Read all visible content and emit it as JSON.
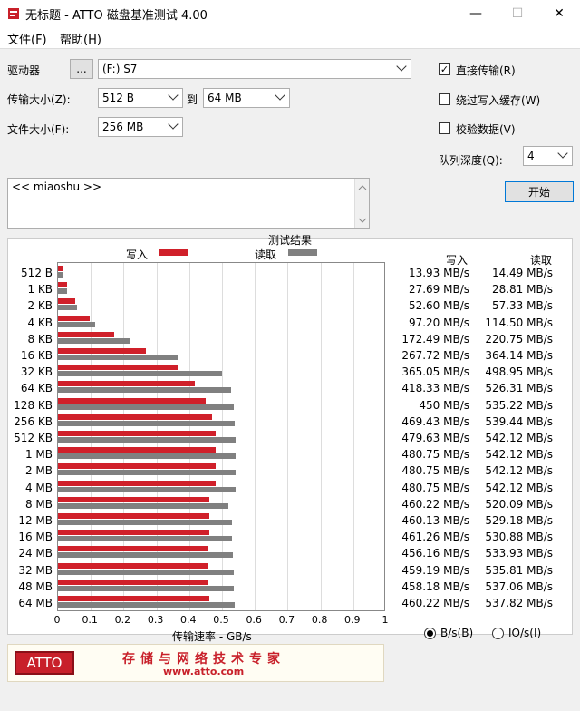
{
  "window": {
    "title": "无标题 - ATTO 磁盘基准测试 4.00",
    "minimize": "—",
    "maximize": "☐",
    "close": "✕"
  },
  "menu": {
    "file": "文件(F)",
    "help": "帮助(H)"
  },
  "drive": {
    "label": "驱动器",
    "browse": "...",
    "value": "(F:) S7"
  },
  "transfer": {
    "label": "传输大小(Z):",
    "from": "512 B",
    "to_label": "到",
    "to": "64 MB"
  },
  "filesize": {
    "label": "文件大小(F):",
    "value": "256 MB"
  },
  "options": {
    "direct_io": {
      "label": "直接传输(R)",
      "checked": true
    },
    "bypass_cache": {
      "label": "绕过写入缓存(W)",
      "checked": false
    },
    "verify": {
      "label": "校验数据(V)",
      "checked": false
    },
    "queue_label": "队列深度(Q):",
    "queue_value": "4",
    "start": "开始"
  },
  "notes": {
    "text": "<< miaoshu >>"
  },
  "results": {
    "title": "测试结果",
    "write_legend": "写入",
    "read_legend": "读取",
    "col_write": "写入",
    "col_read": "读取",
    "xlabel": "传输速率 - GB/s",
    "colors": {
      "write": "#d0202a",
      "read": "#808080"
    }
  },
  "chart_data": {
    "type": "bar",
    "title": "测试结果",
    "xlabel": "传输速率 - GB/s",
    "xlim": [
      0,
      1
    ],
    "xticks": [
      "0",
      "0.1",
      "0.2",
      "0.3",
      "0.4",
      "0.5",
      "0.6",
      "0.7",
      "0.8",
      "0.9",
      "1"
    ],
    "categories": [
      "512 B",
      "1 KB",
      "2 KB",
      "4 KB",
      "8 KB",
      "16 KB",
      "32 KB",
      "64 KB",
      "128 KB",
      "256 KB",
      "512 KB",
      "1 MB",
      "2 MB",
      "4 MB",
      "8 MB",
      "12 MB",
      "16 MB",
      "24 MB",
      "32 MB",
      "48 MB",
      "64 MB"
    ],
    "series": [
      {
        "name": "写入",
        "values": [
          0.01393,
          0.02769,
          0.0526,
          0.0972,
          0.17249,
          0.26772,
          0.36505,
          0.41833,
          0.45,
          0.46943,
          0.47963,
          0.48075,
          0.48075,
          0.48075,
          0.46022,
          0.46013,
          0.46126,
          0.45616,
          0.45919,
          0.45818,
          0.46022
        ]
      },
      {
        "name": "读取",
        "values": [
          0.01449,
          0.02881,
          0.05733,
          0.1145,
          0.22075,
          0.36414,
          0.49895,
          0.52631,
          0.53522,
          0.53944,
          0.54212,
          0.54212,
          0.54212,
          0.54212,
          0.52009,
          0.52918,
          0.53088,
          0.53393,
          0.53581,
          0.53706,
          0.53782
        ]
      }
    ],
    "write_text": [
      "13.93 MB/s",
      "27.69 MB/s",
      "52.60 MB/s",
      "97.20 MB/s",
      "172.49 MB/s",
      "267.72 MB/s",
      "365.05 MB/s",
      "418.33 MB/s",
      "450 MB/s",
      "469.43 MB/s",
      "479.63 MB/s",
      "480.75 MB/s",
      "480.75 MB/s",
      "480.75 MB/s",
      "460.22 MB/s",
      "460.13 MB/s",
      "461.26 MB/s",
      "456.16 MB/s",
      "459.19 MB/s",
      "458.18 MB/s",
      "460.22 MB/s"
    ],
    "read_text": [
      "14.49 MB/s",
      "28.81 MB/s",
      "57.33 MB/s",
      "114.50 MB/s",
      "220.75 MB/s",
      "364.14 MB/s",
      "498.95 MB/s",
      "526.31 MB/s",
      "535.22 MB/s",
      "539.44 MB/s",
      "542.12 MB/s",
      "542.12 MB/s",
      "542.12 MB/s",
      "542.12 MB/s",
      "520.09 MB/s",
      "529.18 MB/s",
      "530.88 MB/s",
      "533.93 MB/s",
      "535.81 MB/s",
      "537.06 MB/s",
      "537.82 MB/s"
    ]
  },
  "units": {
    "bytes": "B/s(B)",
    "io": "IO/s(I)",
    "selected": "bytes"
  },
  "banner": {
    "logo": "ATTO",
    "slogan": "存储与网络技术专家",
    "url": "www.atto.com"
  }
}
